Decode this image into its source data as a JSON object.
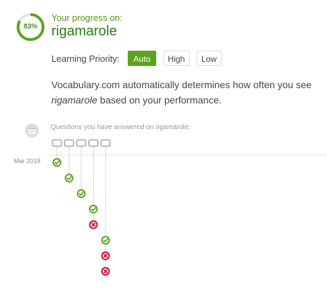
{
  "progress": {
    "percent_label": "83%",
    "percent": 0.83,
    "heading": "Your progress on:",
    "word": "rigamarole"
  },
  "priority": {
    "label": "Learning Priority:",
    "options": [
      "Auto",
      "High",
      "Low"
    ],
    "selected": "Auto"
  },
  "description": {
    "line1": "Vocabulary.com automatically determines how often you see",
    "word": "rigamarole",
    "line2_rest": " based on your performance."
  },
  "history": {
    "label": "Questions you have answered on rigamarole:",
    "month": "Mar 2019",
    "question_count": 5,
    "answers": [
      {
        "question": 1,
        "result": "correct"
      },
      {
        "question": 2,
        "result": "correct"
      },
      {
        "question": 3,
        "result": "correct"
      },
      {
        "question": 4,
        "result": "correct"
      },
      {
        "question": 4,
        "result": "incorrect"
      },
      {
        "question": 5,
        "result": "correct"
      },
      {
        "question": 5,
        "result": "incorrect"
      },
      {
        "question": 5,
        "result": "incorrect"
      }
    ]
  },
  "colors": {
    "correct": "#5aa41f",
    "incorrect": "#c8102e",
    "accent": "#5aa41f"
  }
}
